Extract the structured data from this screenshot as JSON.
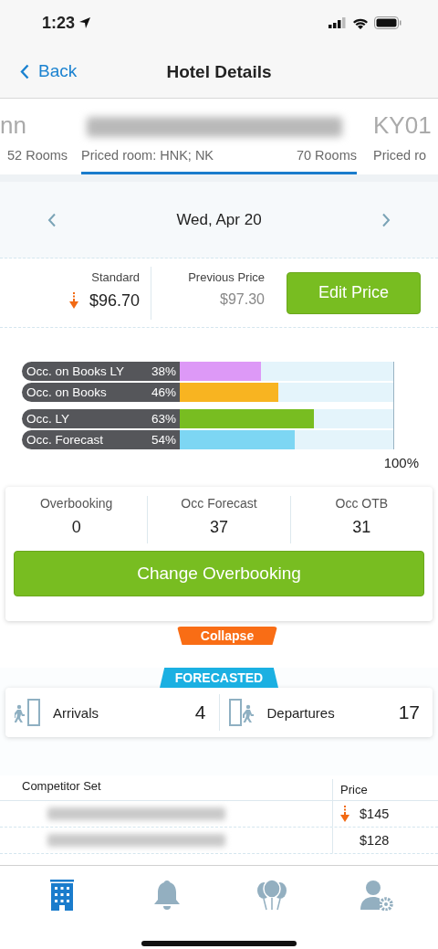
{
  "status_bar": {
    "time": "1:23"
  },
  "nav": {
    "back": "Back",
    "title": "Hotel Details"
  },
  "hotels": [
    {
      "name": "nn",
      "rooms": "52 Rooms",
      "name_redacted": false,
      "selected": false
    },
    {
      "subtitle": "Priced room: HNK; NK",
      "rooms": "70 Rooms",
      "name_redacted": true,
      "selected": true
    },
    {
      "name": "KY01",
      "subtitle": "Priced ro",
      "name_redacted": false,
      "selected": false
    }
  ],
  "date_bar": {
    "date": "Wed, Apr 20"
  },
  "price": {
    "standard_label": "Standard",
    "price_down": true,
    "standard": "$96.70",
    "previous_label": "Previous Price",
    "previous": "$97.30",
    "button": "Edit Price"
  },
  "occupancy": {
    "groups": [
      {
        "rows": [
          {
            "label": "Occ. on Books LY",
            "reading": "38%",
            "level": 0.38,
            "color": "#dd99f7"
          },
          {
            "label": "Occ. on Books",
            "reading": "46%",
            "level": 0.46,
            "color": "#f8b421"
          }
        ]
      },
      {
        "rows": [
          {
            "label": "Occ. LY",
            "reading": "63%",
            "level": 0.63,
            "color": "#78bd21"
          },
          {
            "label": "Occ. Forecast",
            "reading": "54%",
            "level": 0.54,
            "color": "#7dd6f3"
          }
        ]
      }
    ],
    "scale_label": "100%"
  },
  "overbooking": {
    "stats": [
      {
        "label": "Overbooking",
        "value": "0"
      },
      {
        "label": "Occ Forecast",
        "value": "37"
      },
      {
        "label": "Occ OTB",
        "value": "31"
      }
    ],
    "button": "Change Overbooking",
    "collapse": "Collapse"
  },
  "forecast": {
    "tag": "FORECASTED",
    "items": [
      {
        "kind": "arrivals",
        "label": "Arrivals",
        "value": "4"
      },
      {
        "kind": "departures",
        "label": "Departures",
        "value": "17"
      }
    ]
  },
  "competitors": {
    "columns": [
      "Competitor Set",
      "Price"
    ],
    "rows": [
      {
        "name_redacted": true,
        "price_down": true,
        "price": "$145"
      },
      {
        "name_redacted": true,
        "price_down": false,
        "price": "$128"
      }
    ]
  },
  "tab_bar": [
    {
      "kind": "hotel",
      "selected": true
    },
    {
      "kind": "alerts",
      "selected": false
    },
    {
      "kind": "events",
      "selected": false
    },
    {
      "kind": "profile",
      "selected": false
    }
  ]
}
